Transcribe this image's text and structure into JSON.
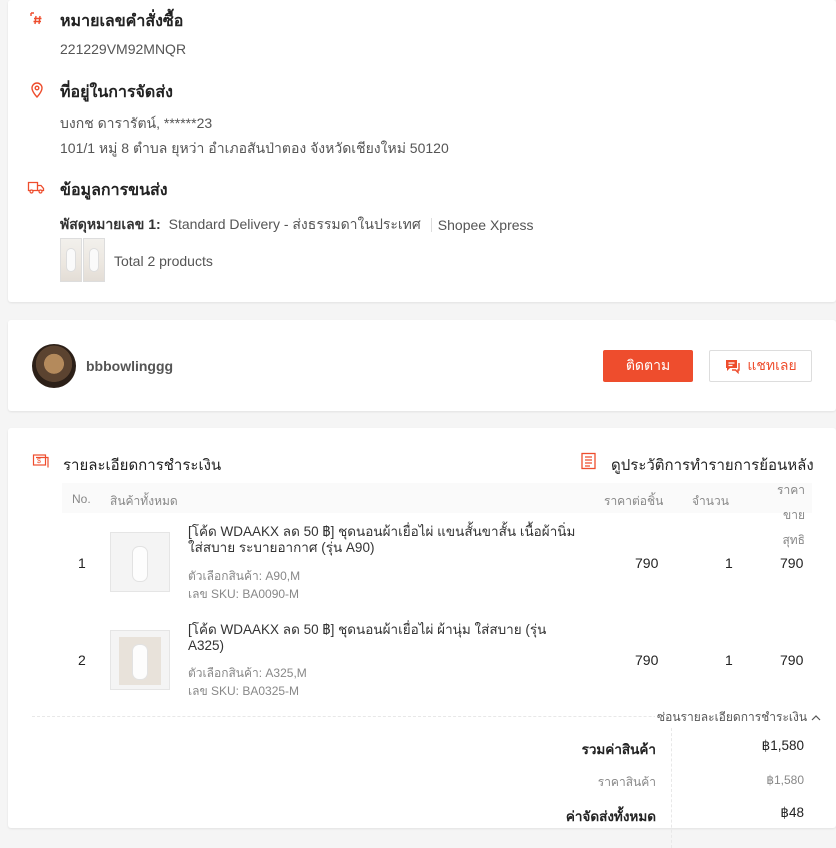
{
  "order": {
    "number_title": "หมายเลขคำสั่งซื้อ",
    "number_value": "221229VM92MNQR",
    "address_title": "ที่อยู่ในการจัดส่ง",
    "recipient": "บงกช ดารารัตน์, ******23",
    "address": "101/1 หมู่ 8 ตำบล ยุหว่า อำเภอสันป่าตอง จังหวัดเชียงใหม่ 50120",
    "shipping_title": "ข้อมูลการขนส่ง",
    "parcel_label": "พัสดุหมายเลข 1:",
    "parcel_method": "Standard Delivery - ส่งธรรมดาในประเทศ",
    "carrier": "Shopee Xpress",
    "total_products": "Total 2 products"
  },
  "seller": {
    "name": "bbbowlinggg",
    "follow_label": "ติดตาม",
    "chat_label": "แชทเลย"
  },
  "payment": {
    "title": "รายละเอียดการชำระเงิน",
    "history_link": "ดูประวัติการทำรายการย้อนหลัง",
    "columns": {
      "no": "No.",
      "all_products": "สินค้าทั้งหมด",
      "unit_price": "ราคาต่อชิ้น",
      "qty": "จำนวน",
      "net_price_line1": "ราคาขาย",
      "net_price_line2": "สุทธิ"
    },
    "items": [
      {
        "no": "1",
        "name": "[โค้ด WDAAKX ลด 50 ฿] ชุดนอนผ้าเยื่อไผ่ แขนสั้นขาสั้น เนื้อผ้านิ่ม ใส่สบาย ระบายอากาศ (รุ่น A90)",
        "variant": "ตัวเลือกสินค้า: A90,M",
        "sku": "เลข SKU: BA0090-M",
        "price": "790",
        "qty": "1",
        "total": "790"
      },
      {
        "no": "2",
        "name": "[โค้ด WDAAKX ลด 50 ฿] ชุดนอนผ้าเยื่อไผ่ ผ้านุ่ม ใส่สบาย (รุ่น A325)",
        "variant": "ตัวเลือกสินค้า: A325,M",
        "sku": "เลข SKU: BA0325-M",
        "price": "790",
        "qty": "1",
        "total": "790"
      }
    ],
    "hide_details": "ซ่อนรายละเอียดการชำระเงิน",
    "summary": [
      {
        "label": "รวมค่าสินค้า",
        "value": "฿1,580"
      },
      {
        "label": "ราคาสินค้า",
        "value": "฿1,580"
      },
      {
        "label": "ค่าจัดส่งทั้งหมด",
        "value": "฿48"
      }
    ]
  },
  "colors": {
    "accent": "#ee4d2d"
  },
  "icons": {
    "order_number": "hash-icon",
    "address": "location-pin-icon",
    "shipping": "truck-icon",
    "payment": "receipt-icon",
    "history": "document-list-icon",
    "chat": "chat-bubble-icon",
    "collapse": "chevron-up-icon"
  }
}
